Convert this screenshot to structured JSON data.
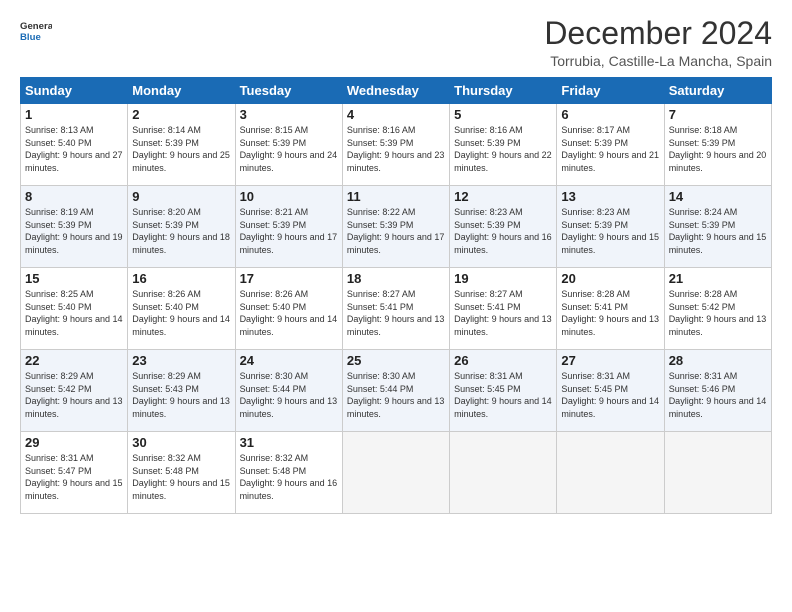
{
  "header": {
    "logo_line1": "General",
    "logo_line2": "Blue",
    "title": "December 2024",
    "location": "Torrubia, Castille-La Mancha, Spain"
  },
  "days_of_week": [
    "Sunday",
    "Monday",
    "Tuesday",
    "Wednesday",
    "Thursday",
    "Friday",
    "Saturday"
  ],
  "weeks": [
    [
      {
        "day": "1",
        "text": "Sunrise: 8:13 AM\nSunset: 5:40 PM\nDaylight: 9 hours and 27 minutes."
      },
      {
        "day": "2",
        "text": "Sunrise: 8:14 AM\nSunset: 5:39 PM\nDaylight: 9 hours and 25 minutes."
      },
      {
        "day": "3",
        "text": "Sunrise: 8:15 AM\nSunset: 5:39 PM\nDaylight: 9 hours and 24 minutes."
      },
      {
        "day": "4",
        "text": "Sunrise: 8:16 AM\nSunset: 5:39 PM\nDaylight: 9 hours and 23 minutes."
      },
      {
        "day": "5",
        "text": "Sunrise: 8:16 AM\nSunset: 5:39 PM\nDaylight: 9 hours and 22 minutes."
      },
      {
        "day": "6",
        "text": "Sunrise: 8:17 AM\nSunset: 5:39 PM\nDaylight: 9 hours and 21 minutes."
      },
      {
        "day": "7",
        "text": "Sunrise: 8:18 AM\nSunset: 5:39 PM\nDaylight: 9 hours and 20 minutes."
      }
    ],
    [
      {
        "day": "8",
        "text": "Sunrise: 8:19 AM\nSunset: 5:39 PM\nDaylight: 9 hours and 19 minutes."
      },
      {
        "day": "9",
        "text": "Sunrise: 8:20 AM\nSunset: 5:39 PM\nDaylight: 9 hours and 18 minutes."
      },
      {
        "day": "10",
        "text": "Sunrise: 8:21 AM\nSunset: 5:39 PM\nDaylight: 9 hours and 17 minutes."
      },
      {
        "day": "11",
        "text": "Sunrise: 8:22 AM\nSunset: 5:39 PM\nDaylight: 9 hours and 17 minutes."
      },
      {
        "day": "12",
        "text": "Sunrise: 8:23 AM\nSunset: 5:39 PM\nDaylight: 9 hours and 16 minutes."
      },
      {
        "day": "13",
        "text": "Sunrise: 8:23 AM\nSunset: 5:39 PM\nDaylight: 9 hours and 15 minutes."
      },
      {
        "day": "14",
        "text": "Sunrise: 8:24 AM\nSunset: 5:39 PM\nDaylight: 9 hours and 15 minutes."
      }
    ],
    [
      {
        "day": "15",
        "text": "Sunrise: 8:25 AM\nSunset: 5:40 PM\nDaylight: 9 hours and 14 minutes."
      },
      {
        "day": "16",
        "text": "Sunrise: 8:26 AM\nSunset: 5:40 PM\nDaylight: 9 hours and 14 minutes."
      },
      {
        "day": "17",
        "text": "Sunrise: 8:26 AM\nSunset: 5:40 PM\nDaylight: 9 hours and 14 minutes."
      },
      {
        "day": "18",
        "text": "Sunrise: 8:27 AM\nSunset: 5:41 PM\nDaylight: 9 hours and 13 minutes."
      },
      {
        "day": "19",
        "text": "Sunrise: 8:27 AM\nSunset: 5:41 PM\nDaylight: 9 hours and 13 minutes."
      },
      {
        "day": "20",
        "text": "Sunrise: 8:28 AM\nSunset: 5:41 PM\nDaylight: 9 hours and 13 minutes."
      },
      {
        "day": "21",
        "text": "Sunrise: 8:28 AM\nSunset: 5:42 PM\nDaylight: 9 hours and 13 minutes."
      }
    ],
    [
      {
        "day": "22",
        "text": "Sunrise: 8:29 AM\nSunset: 5:42 PM\nDaylight: 9 hours and 13 minutes."
      },
      {
        "day": "23",
        "text": "Sunrise: 8:29 AM\nSunset: 5:43 PM\nDaylight: 9 hours and 13 minutes."
      },
      {
        "day": "24",
        "text": "Sunrise: 8:30 AM\nSunset: 5:44 PM\nDaylight: 9 hours and 13 minutes."
      },
      {
        "day": "25",
        "text": "Sunrise: 8:30 AM\nSunset: 5:44 PM\nDaylight: 9 hours and 13 minutes."
      },
      {
        "day": "26",
        "text": "Sunrise: 8:31 AM\nSunset: 5:45 PM\nDaylight: 9 hours and 14 minutes."
      },
      {
        "day": "27",
        "text": "Sunrise: 8:31 AM\nSunset: 5:45 PM\nDaylight: 9 hours and 14 minutes."
      },
      {
        "day": "28",
        "text": "Sunrise: 8:31 AM\nSunset: 5:46 PM\nDaylight: 9 hours and 14 minutes."
      }
    ],
    [
      {
        "day": "29",
        "text": "Sunrise: 8:31 AM\nSunset: 5:47 PM\nDaylight: 9 hours and 15 minutes."
      },
      {
        "day": "30",
        "text": "Sunrise: 8:32 AM\nSunset: 5:48 PM\nDaylight: 9 hours and 15 minutes."
      },
      {
        "day": "31",
        "text": "Sunrise: 8:32 AM\nSunset: 5:48 PM\nDaylight: 9 hours and 16 minutes."
      },
      {
        "day": "",
        "text": ""
      },
      {
        "day": "",
        "text": ""
      },
      {
        "day": "",
        "text": ""
      },
      {
        "day": "",
        "text": ""
      }
    ]
  ]
}
